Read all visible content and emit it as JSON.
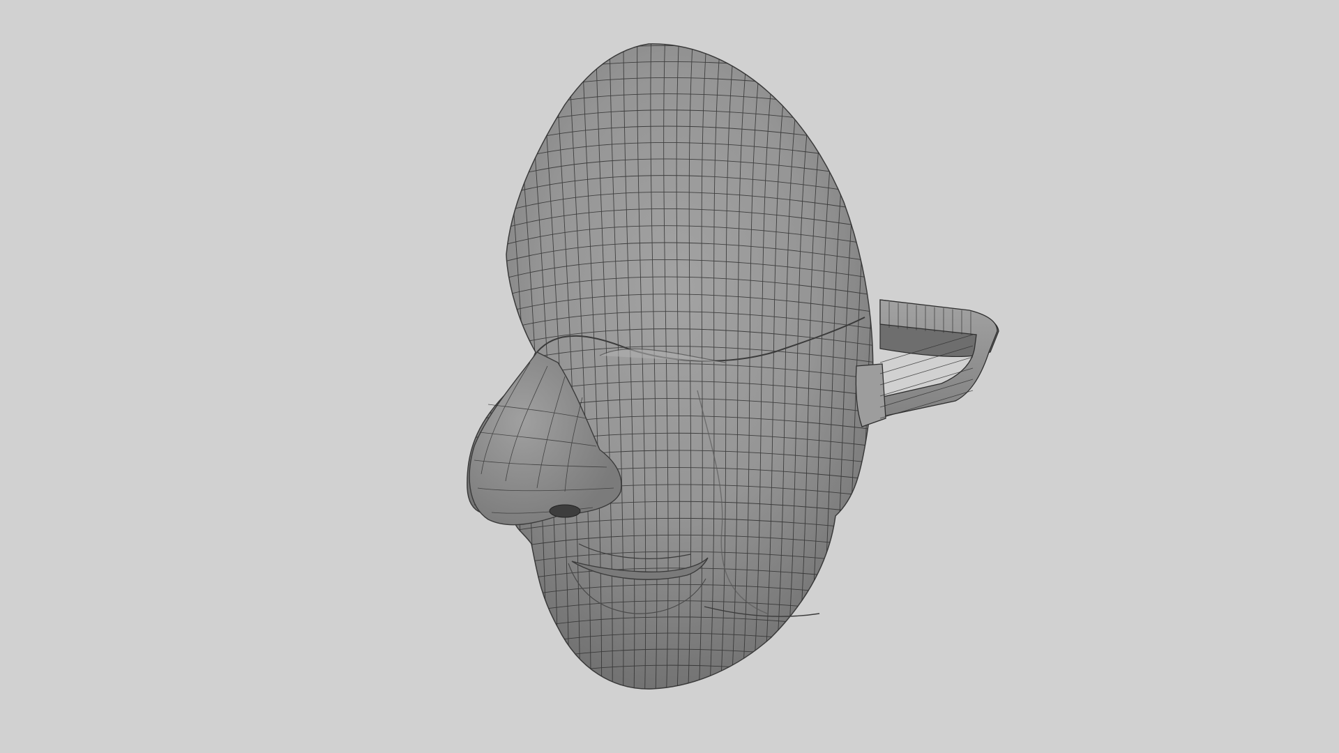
{
  "scene": {
    "subject": "mask-model-wireframe",
    "background_color": "#d1d1d1",
    "mesh_color": "#8f8f8f",
    "wire_color": "#2e2e2e",
    "shading": "flat-shaded-with-wireframe"
  }
}
